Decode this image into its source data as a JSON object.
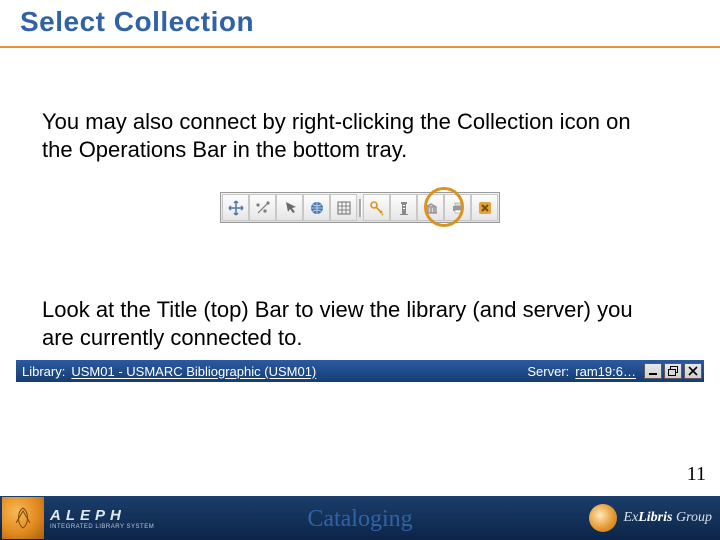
{
  "title": "Select Collection",
  "body1": "You may also connect by right-clicking the Collection icon on the Operations Bar in the bottom tray.",
  "body2": "Look at the Title (top) Bar to view the library (and server) you are currently connected to.",
  "toolbar": {
    "icons": [
      "move",
      "wand",
      "pointer",
      "globe",
      "grid",
      "key",
      "tower",
      "building",
      "printer",
      "close"
    ]
  },
  "titlebar": {
    "library_label": "Library:",
    "library_value": "USM01 - USMARC Bibliographic (USM01)",
    "server_label": "Server:",
    "server_value": "ram19:6…"
  },
  "page_number": "11",
  "footer": {
    "center": "Cataloging",
    "aleph_name": "ALEPH",
    "aleph_sub": "INTEGRATED LIBRARY SYSTEM",
    "exlibris_pre": "Ex",
    "exlibris_em": "Libris",
    "exlibris_post": " Group"
  }
}
